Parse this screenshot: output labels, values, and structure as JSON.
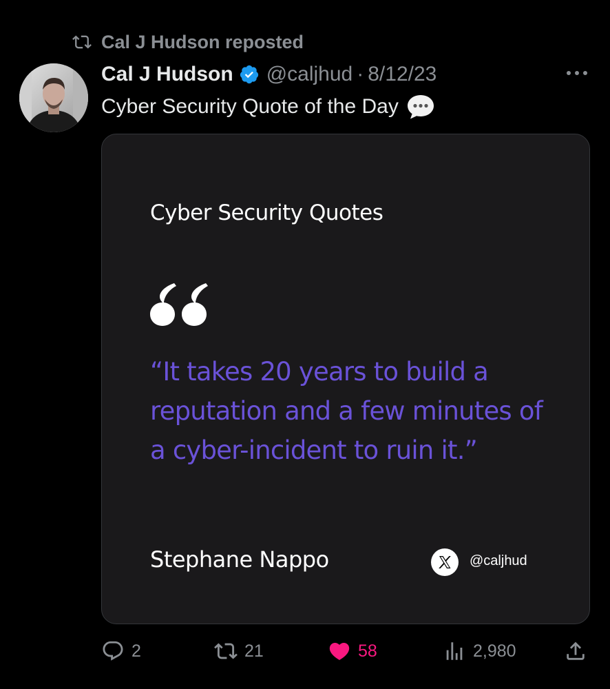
{
  "repost": {
    "label": "Cal J Hudson reposted",
    "icon": "repost-icon"
  },
  "tweet": {
    "author_name": "Cal J Hudson",
    "verified": true,
    "handle": "@caljhud",
    "separator": "·",
    "date": "8/12/23",
    "text": "Cyber Security Quote of the Day",
    "emoji_icon": "speech-bubble-icon"
  },
  "card": {
    "title": "Cyber Security Quotes",
    "quote": "“It takes 20 years to build a reputation and a few minutes of a cyber-incident to ruin it.”",
    "author": "Stephane Nappo",
    "brand_icon": "x-logo-icon",
    "handle": "@caljhud"
  },
  "actions": {
    "replies": "2",
    "reposts": "21",
    "likes": "58",
    "views": "2,980"
  },
  "colors": {
    "background": "#000000",
    "text_primary": "#e7e9ea",
    "text_secondary": "#8b8f94",
    "verified_blue": "#1d9bf0",
    "like_pink": "#f91880",
    "quote_purple": "#6a52d8",
    "card_background": "#1a191b"
  }
}
